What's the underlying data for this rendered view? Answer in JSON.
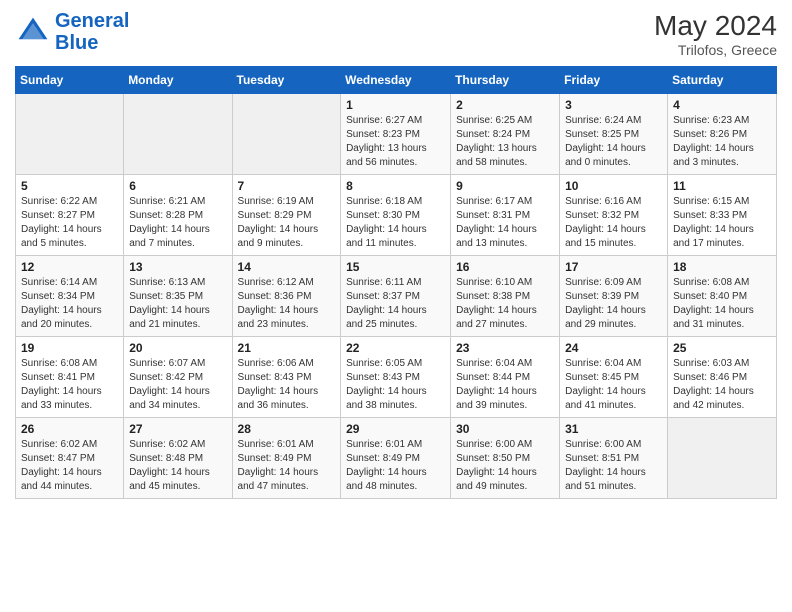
{
  "header": {
    "logo_line1": "General",
    "logo_line2": "Blue",
    "month_year": "May 2024",
    "location": "Trilofos, Greece"
  },
  "weekdays": [
    "Sunday",
    "Monday",
    "Tuesday",
    "Wednesday",
    "Thursday",
    "Friday",
    "Saturday"
  ],
  "weeks": [
    [
      {
        "day": "",
        "info": ""
      },
      {
        "day": "",
        "info": ""
      },
      {
        "day": "",
        "info": ""
      },
      {
        "day": "1",
        "info": "Sunrise: 6:27 AM\nSunset: 8:23 PM\nDaylight: 13 hours\nand 56 minutes."
      },
      {
        "day": "2",
        "info": "Sunrise: 6:25 AM\nSunset: 8:24 PM\nDaylight: 13 hours\nand 58 minutes."
      },
      {
        "day": "3",
        "info": "Sunrise: 6:24 AM\nSunset: 8:25 PM\nDaylight: 14 hours\nand 0 minutes."
      },
      {
        "day": "4",
        "info": "Sunrise: 6:23 AM\nSunset: 8:26 PM\nDaylight: 14 hours\nand 3 minutes."
      }
    ],
    [
      {
        "day": "5",
        "info": "Sunrise: 6:22 AM\nSunset: 8:27 PM\nDaylight: 14 hours\nand 5 minutes."
      },
      {
        "day": "6",
        "info": "Sunrise: 6:21 AM\nSunset: 8:28 PM\nDaylight: 14 hours\nand 7 minutes."
      },
      {
        "day": "7",
        "info": "Sunrise: 6:19 AM\nSunset: 8:29 PM\nDaylight: 14 hours\nand 9 minutes."
      },
      {
        "day": "8",
        "info": "Sunrise: 6:18 AM\nSunset: 8:30 PM\nDaylight: 14 hours\nand 11 minutes."
      },
      {
        "day": "9",
        "info": "Sunrise: 6:17 AM\nSunset: 8:31 PM\nDaylight: 14 hours\nand 13 minutes."
      },
      {
        "day": "10",
        "info": "Sunrise: 6:16 AM\nSunset: 8:32 PM\nDaylight: 14 hours\nand 15 minutes."
      },
      {
        "day": "11",
        "info": "Sunrise: 6:15 AM\nSunset: 8:33 PM\nDaylight: 14 hours\nand 17 minutes."
      }
    ],
    [
      {
        "day": "12",
        "info": "Sunrise: 6:14 AM\nSunset: 8:34 PM\nDaylight: 14 hours\nand 20 minutes."
      },
      {
        "day": "13",
        "info": "Sunrise: 6:13 AM\nSunset: 8:35 PM\nDaylight: 14 hours\nand 21 minutes."
      },
      {
        "day": "14",
        "info": "Sunrise: 6:12 AM\nSunset: 8:36 PM\nDaylight: 14 hours\nand 23 minutes."
      },
      {
        "day": "15",
        "info": "Sunrise: 6:11 AM\nSunset: 8:37 PM\nDaylight: 14 hours\nand 25 minutes."
      },
      {
        "day": "16",
        "info": "Sunrise: 6:10 AM\nSunset: 8:38 PM\nDaylight: 14 hours\nand 27 minutes."
      },
      {
        "day": "17",
        "info": "Sunrise: 6:09 AM\nSunset: 8:39 PM\nDaylight: 14 hours\nand 29 minutes."
      },
      {
        "day": "18",
        "info": "Sunrise: 6:08 AM\nSunset: 8:40 PM\nDaylight: 14 hours\nand 31 minutes."
      }
    ],
    [
      {
        "day": "19",
        "info": "Sunrise: 6:08 AM\nSunset: 8:41 PM\nDaylight: 14 hours\nand 33 minutes."
      },
      {
        "day": "20",
        "info": "Sunrise: 6:07 AM\nSunset: 8:42 PM\nDaylight: 14 hours\nand 34 minutes."
      },
      {
        "day": "21",
        "info": "Sunrise: 6:06 AM\nSunset: 8:43 PM\nDaylight: 14 hours\nand 36 minutes."
      },
      {
        "day": "22",
        "info": "Sunrise: 6:05 AM\nSunset: 8:43 PM\nDaylight: 14 hours\nand 38 minutes."
      },
      {
        "day": "23",
        "info": "Sunrise: 6:04 AM\nSunset: 8:44 PM\nDaylight: 14 hours\nand 39 minutes."
      },
      {
        "day": "24",
        "info": "Sunrise: 6:04 AM\nSunset: 8:45 PM\nDaylight: 14 hours\nand 41 minutes."
      },
      {
        "day": "25",
        "info": "Sunrise: 6:03 AM\nSunset: 8:46 PM\nDaylight: 14 hours\nand 42 minutes."
      }
    ],
    [
      {
        "day": "26",
        "info": "Sunrise: 6:02 AM\nSunset: 8:47 PM\nDaylight: 14 hours\nand 44 minutes."
      },
      {
        "day": "27",
        "info": "Sunrise: 6:02 AM\nSunset: 8:48 PM\nDaylight: 14 hours\nand 45 minutes."
      },
      {
        "day": "28",
        "info": "Sunrise: 6:01 AM\nSunset: 8:49 PM\nDaylight: 14 hours\nand 47 minutes."
      },
      {
        "day": "29",
        "info": "Sunrise: 6:01 AM\nSunset: 8:49 PM\nDaylight: 14 hours\nand 48 minutes."
      },
      {
        "day": "30",
        "info": "Sunrise: 6:00 AM\nSunset: 8:50 PM\nDaylight: 14 hours\nand 49 minutes."
      },
      {
        "day": "31",
        "info": "Sunrise: 6:00 AM\nSunset: 8:51 PM\nDaylight: 14 hours\nand 51 minutes."
      },
      {
        "day": "",
        "info": ""
      }
    ]
  ]
}
